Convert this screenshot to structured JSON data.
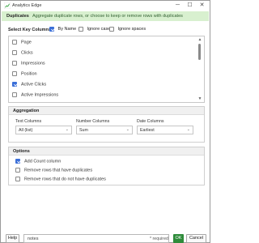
{
  "window": {
    "title": "Analytics Edge",
    "minimize": "─",
    "maximize": "☐",
    "close": "✕"
  },
  "banner": {
    "title": "Duplicates",
    "subtitle": "Aggregate duplicate rows, or choose to keep or remove rows with duplicates"
  },
  "key_columns": {
    "label": "Select Key Columns",
    "by_name": {
      "label": "By Name",
      "checked": true
    },
    "ignore_case": {
      "label": "Ignore case",
      "checked": false
    },
    "ignore_spaces": {
      "label": "Ignore spaces",
      "checked": false
    },
    "items": [
      {
        "label": "Page",
        "checked": false
      },
      {
        "label": "Clicks",
        "checked": false
      },
      {
        "label": "Impressions",
        "checked": false
      },
      {
        "label": "Position",
        "checked": false
      },
      {
        "label": "Active Clicks",
        "checked": true
      },
      {
        "label": "Active Impressions",
        "checked": false
      }
    ]
  },
  "aggregation": {
    "title": "Aggregation",
    "text_columns": {
      "label": "Text Columns",
      "value": "All (list)"
    },
    "number_columns": {
      "label": "Number Columns",
      "value": "Sum"
    },
    "date_columns": {
      "label": "Date Columns",
      "value": "Earliest"
    }
  },
  "options": {
    "title": "Options",
    "items": [
      {
        "label": "Add Count column",
        "checked": true
      },
      {
        "label": "Remove rows that have duplicates",
        "checked": false
      },
      {
        "label": "Remove rows that do not have duplicates",
        "checked": false
      }
    ]
  },
  "footer": {
    "help": "Help",
    "notes_value": "notes",
    "required": "* required",
    "ok": "OK",
    "cancel": "Cancel"
  },
  "colors": {
    "banner_bg": "#d8f0cf",
    "accent": "#3b6fd8",
    "ok_bg": "#2e8b3a"
  }
}
